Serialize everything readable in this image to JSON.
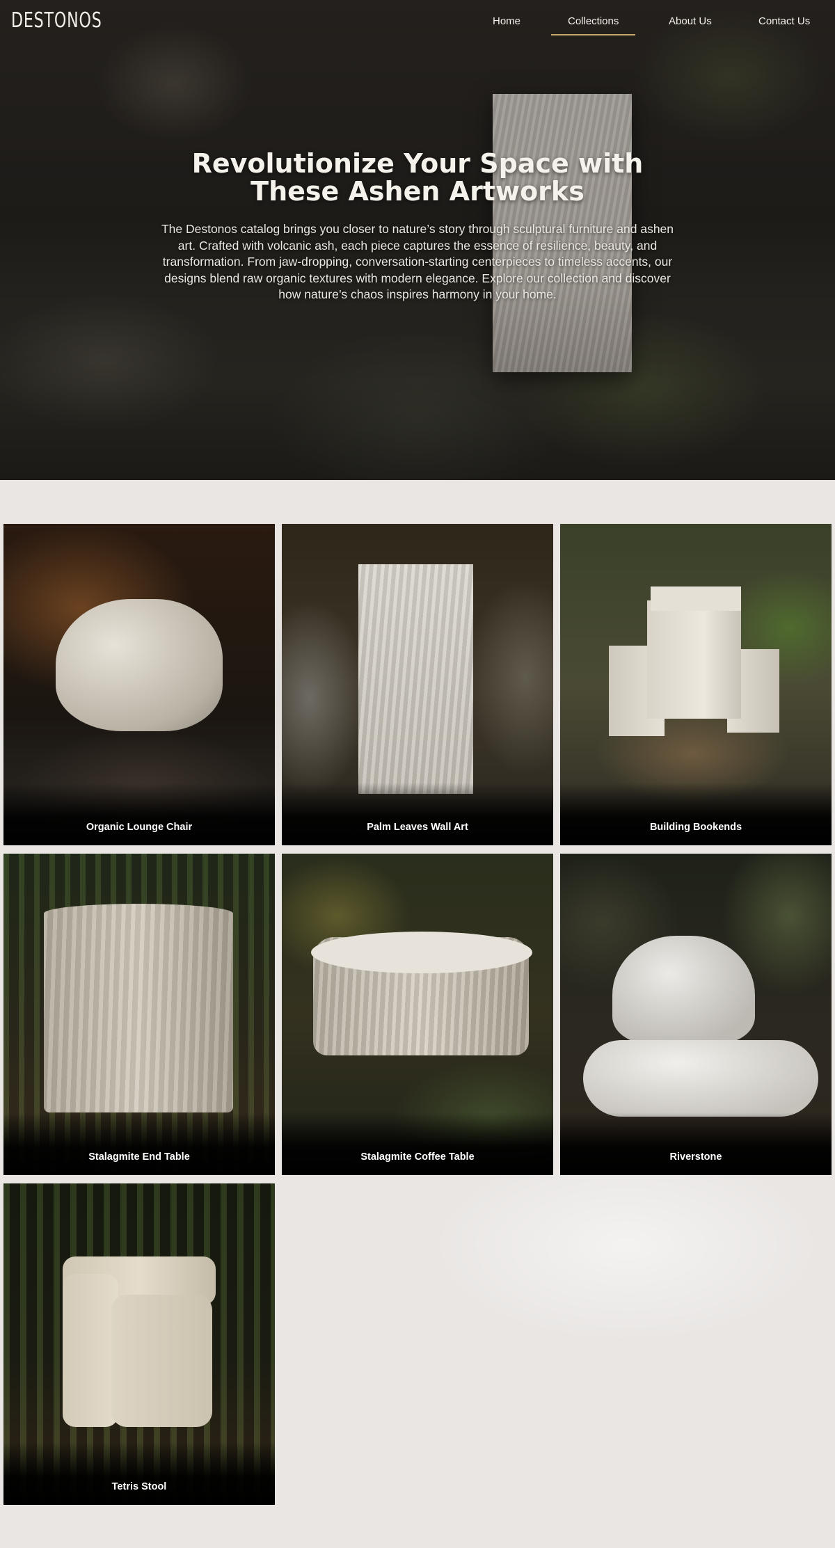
{
  "brand": {
    "logo_text": "DESTONOS"
  },
  "nav": {
    "items": [
      {
        "label": "Home"
      },
      {
        "label": "Collections",
        "active": true
      },
      {
        "label": "About Us"
      },
      {
        "label": "Contact Us"
      }
    ],
    "accent_color": "#c9a96e"
  },
  "hero": {
    "title_line1": "Revolutionize Your Space with",
    "title_line2": "These Ashen Artworks",
    "description": "The Destonos catalog brings you closer to nature’s story through sculptural furniture and ashen art. Crafted with volcanic ash, each piece captures the essence of resilience, beauty, and transformation. From jaw-dropping, conversation-starting centerpieces to timeless accents, our designs blend raw organic textures with modern elegance. Explore our collection and discover how nature’s chaos inspires harmony in your home."
  },
  "products": [
    {
      "name": "Organic Lounge Chair"
    },
    {
      "name": "Palm Leaves Wall Art"
    },
    {
      "name": "Building Bookends"
    },
    {
      "name": "Stalagmite End Table"
    },
    {
      "name": "Stalagmite Coffee Table"
    },
    {
      "name": "Riverstone"
    },
    {
      "name": "Tetris Stool"
    }
  ]
}
